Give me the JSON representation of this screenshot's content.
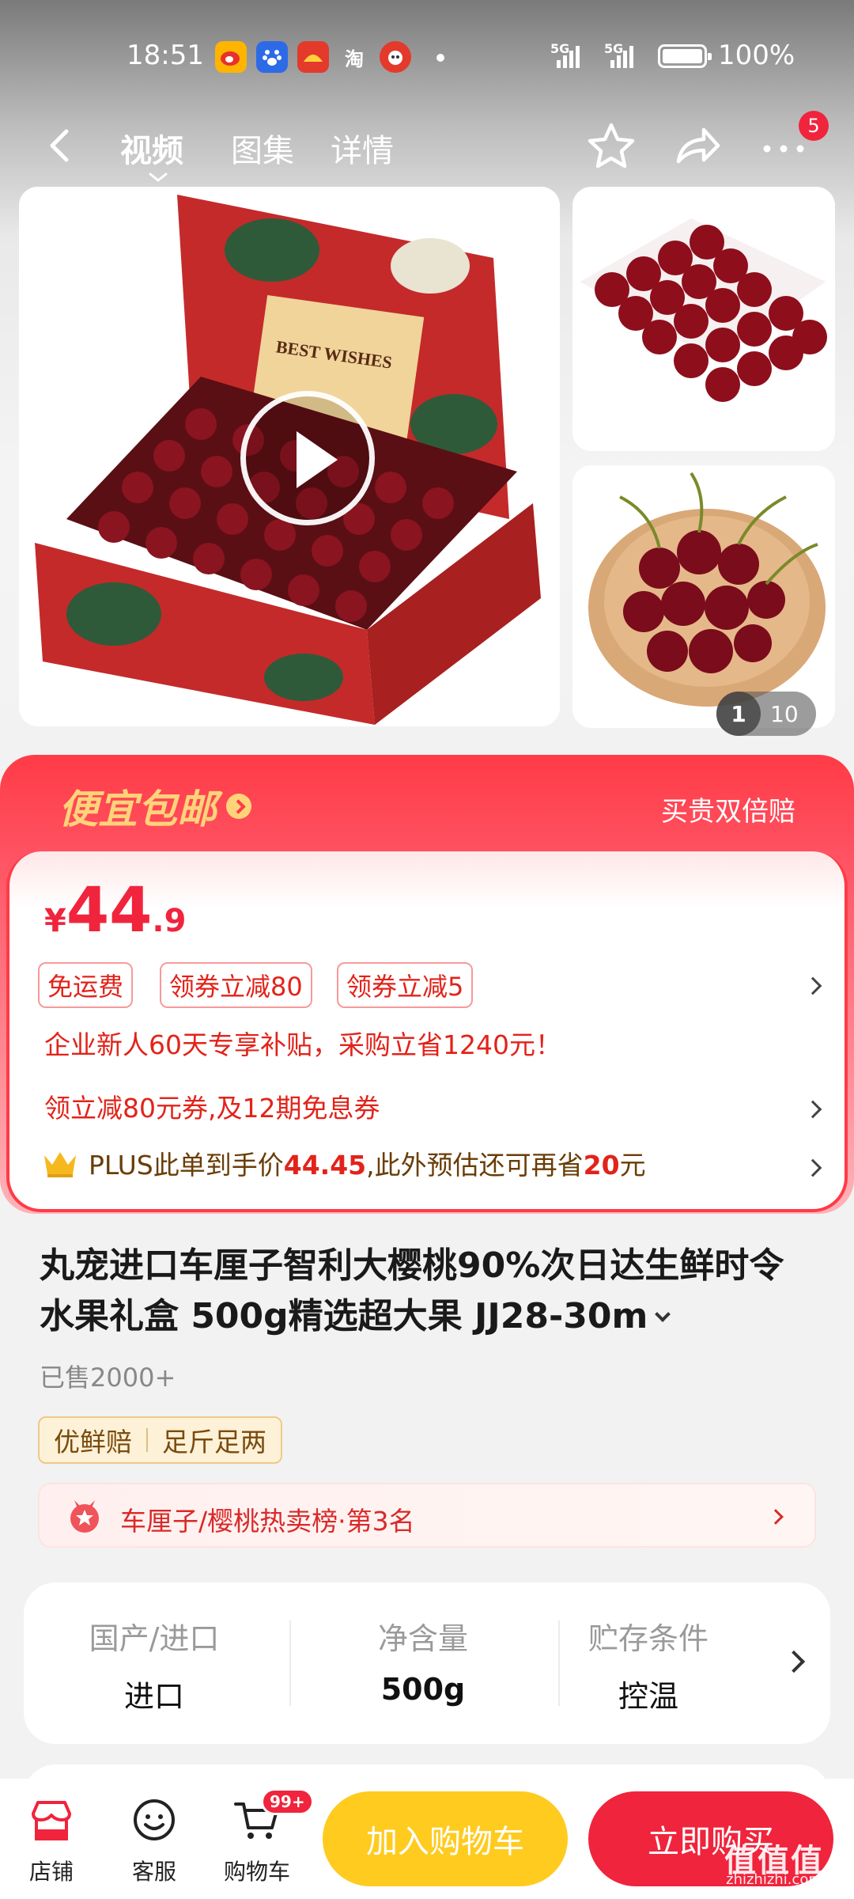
{
  "status_bar": {
    "time": "18:51",
    "notif_apps": [
      "weibo-icon",
      "baidu-icon",
      "app-icon",
      "taobao-icon",
      "mascot-icon"
    ],
    "taobao_label": "淘",
    "signal_1": "5G",
    "signal_2": "5G",
    "battery": "100%"
  },
  "nav": {
    "tabs": [
      {
        "label": "视频",
        "active": true
      },
      {
        "label": "图集",
        "active": false
      },
      {
        "label": "详情",
        "active": false
      }
    ],
    "more_badge": "5"
  },
  "gallery": {
    "current_page": "1",
    "total_pages": "10",
    "box_text": "BEST WISHES"
  },
  "promo": {
    "banner": "便宜包邮",
    "guarantee": "买贵双倍赔",
    "price_currency": "¥",
    "price_integer": "44",
    "price_decimal": ".9",
    "tags": [
      "免运费",
      "领券立减80",
      "领券立减5"
    ],
    "enterprise_offer": "企业新人60天专享补贴，采购立省1240元！",
    "coupon_offer": "领立减80元券,及12期免息券",
    "plus_prefix": "PLUS此单到手价",
    "plus_price": "44.45",
    "plus_middle": ",此外预估还可再省",
    "plus_save": "20",
    "plus_suffix": "元"
  },
  "product": {
    "title": "丸宠进口车厘子智利大樱桃90%次日达生鲜时令水果礼盒 500g精选超大果  JJ28-30m",
    "sold": "已售2000+",
    "guarantees": [
      "优鲜赔",
      "足斤足两"
    ],
    "rank": "车厘子/樱桃热卖榜·第3名"
  },
  "specs": [
    {
      "label": "国产/进口",
      "value": "进口"
    },
    {
      "label": "净含量",
      "value": "500g"
    },
    {
      "label": "贮存条件",
      "value": "控温"
    }
  ],
  "bottom_bar": {
    "shop": "店铺",
    "service": "客服",
    "cart": "购物车",
    "cart_badge": "99+",
    "add_to_cart": "加入购物车",
    "buy_now": "立即购买"
  },
  "watermark": {
    "line1": "值值值",
    "line2": "zhizhizhi.com"
  },
  "colors": {
    "brand_red": "#f0243c",
    "cart_yellow": "#ffcb1f",
    "banner_gold": "#ffd37a"
  }
}
